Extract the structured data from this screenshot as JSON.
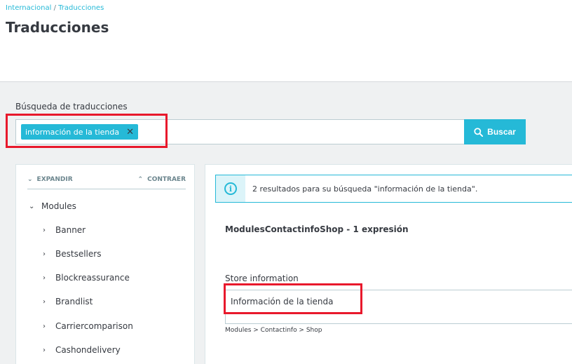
{
  "breadcrumb": {
    "parent": "Internacional",
    "separator": " / ",
    "current": "Traducciones"
  },
  "page": {
    "title": "Traducciones"
  },
  "search": {
    "label": "Búsqueda de traducciones",
    "tag": "información de la tienda",
    "button_label": "Buscar"
  },
  "tree": {
    "expand_label": "EXPANDIR",
    "collapse_label": "CONTRAER",
    "root": "Modules",
    "items": [
      "Banner",
      "Bestsellers",
      "Blockreassurance",
      "Brandlist",
      "Carriercomparison",
      "Cashondelivery"
    ]
  },
  "results": {
    "alert_text": "2 resultados para su búsqueda \"información de la tienda\".",
    "domain_title": "ModulesContactinfoShop - 1 expresión",
    "field_label": "Store information",
    "field_value": "Información de la tienda",
    "field_path": "Modules > Contactinfo > Shop"
  },
  "colors": {
    "accent": "#25b9d7",
    "highlight": "#e8192c",
    "background": "#eff1f2"
  }
}
